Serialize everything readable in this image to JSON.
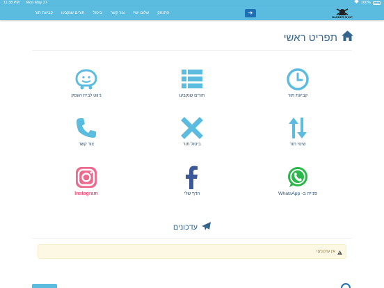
{
  "statusbar": {
    "time": "11:38 PM",
    "date": "Mon May 27",
    "battery": "100%"
  },
  "nav": {
    "links": [
      "קביעת תור",
      "תורים שנקבעו",
      "ביטול",
      "צור קשר",
      "שלום ישי!",
      "התנתק"
    ],
    "logo_text": "BARBER SHOP",
    "logout_arrow": "➜"
  },
  "page": {
    "title": "תפריט ראשי"
  },
  "tiles": {
    "book": "קביעת תור",
    "my_appointments": "תורים שנקבעו",
    "waze": "ניווט לבית העסק",
    "change": "שינוי תור",
    "cancel": "ביטול תור",
    "contact": "צור קשר",
    "whatsapp": "פנייה ב- WhatsApp",
    "facebook": "הדף שלי",
    "instagram": "Instagram"
  },
  "updates": {
    "title": "עדכונים",
    "empty": "אין עדכונים!"
  },
  "colors": {
    "nav": "#5bbce0",
    "accent": "#1f6fb5",
    "title": "#35658e",
    "icon": "#5bbce0"
  }
}
